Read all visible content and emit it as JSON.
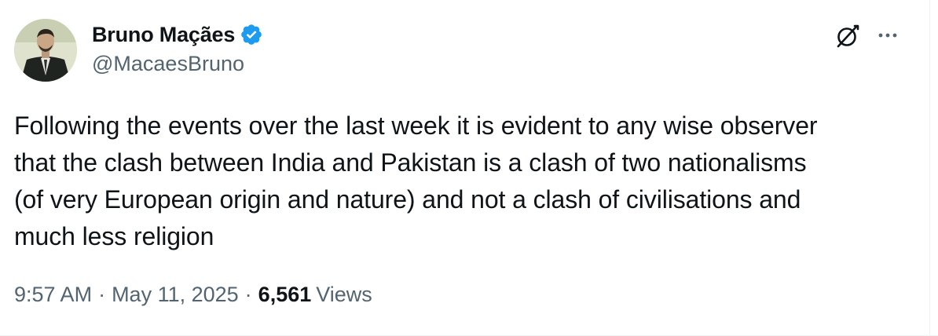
{
  "author": {
    "display_name": "Bruno Maçães",
    "handle": "@MacaesBruno",
    "verified": true,
    "verified_color": "#1d9bf0"
  },
  "header_actions": {
    "grok_icon": "grok-icon",
    "more_icon": "more-icon"
  },
  "tweet": {
    "lines": [
      "Following the events over the last week it is evident to any wise observer",
      "that the clash between India and Pakistan is a clash of two nationalisms",
      "(of very European origin and nature) and not a clash of civilisations and",
      "much less religion"
    ]
  },
  "meta": {
    "time": "9:57 AM",
    "separator": "·",
    "date": "May 11, 2025",
    "views_count": "6,561",
    "views_label": "Views"
  },
  "colors": {
    "text_primary": "#0f1419",
    "text_secondary": "#536471",
    "verified_blue": "#1d9bf0"
  }
}
